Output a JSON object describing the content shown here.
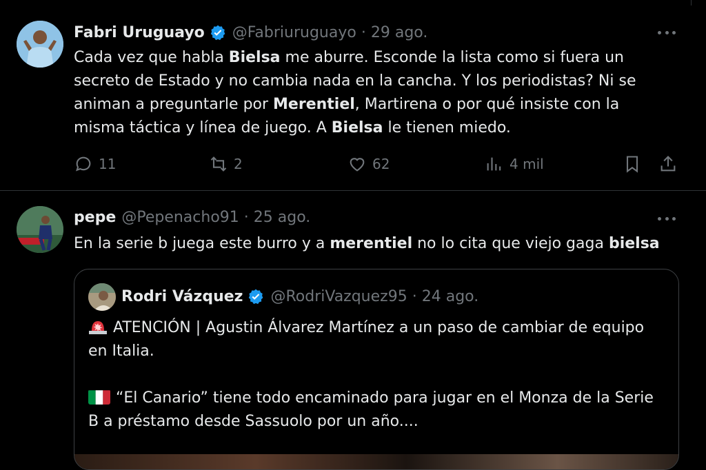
{
  "tweets": [
    {
      "author_name": "Fabri Uruguayo",
      "handle": "@Fabriuruguayo",
      "separator": "·",
      "date": "29 ago.",
      "verified": true,
      "text_parts": [
        "Cada vez que habla ",
        "Bielsa",
        " me aburre. Esconde la lista como si fuera un secreto de Estado y no cambia nada en la cancha. Y los periodistas? Ni se animan a preguntarle por ",
        "Merentiel",
        ", Martirena o por qué insiste con la misma táctica y línea de juego. A ",
        "Bielsa",
        " le tienen miedo."
      ],
      "stats": {
        "replies": "11",
        "retweets": "2",
        "likes": "62",
        "views": "4 mil"
      }
    },
    {
      "author_name": "pepe",
      "handle": "@Pepenacho91",
      "separator": "·",
      "date": "25 ago.",
      "verified": false,
      "text_parts": [
        "En la serie b juega este burro y a ",
        "merentiel",
        " no lo cita que viejo gaga ",
        "bielsa"
      ],
      "quote": {
        "author_name": "Rodri Vázquez",
        "handle": "@RodriVazquez95",
        "separator": "·",
        "date": "24 ago.",
        "verified": true,
        "line1": "ATENCIÓN | Agustin Álvarez Martínez a un paso de cambiar de equipo en Italia.",
        "line2": "“El Canario” tiene todo encaminado para jugar en el Monza de la Serie B a préstamo desde Sassuolo por un año...."
      }
    }
  ],
  "colors": {
    "background": "#000000",
    "text": "#e7e9ea",
    "muted": "#71767b",
    "verified": "#1d9bf0",
    "border": "#2f3336"
  },
  "icons": [
    "verified-badge-icon",
    "more-icon",
    "reply-icon",
    "retweet-icon",
    "like-icon",
    "views-icon",
    "bookmark-icon",
    "share-icon",
    "alert-siren-icon",
    "italy-flag-icon"
  ]
}
